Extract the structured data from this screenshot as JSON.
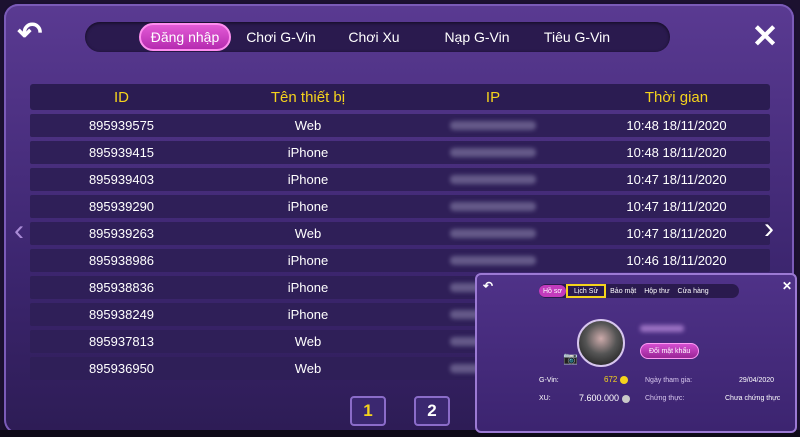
{
  "nav": {
    "tabs": [
      {
        "label": "Đăng nhập"
      },
      {
        "label": "Chơi G-Vin"
      },
      {
        "label": "Chơi Xu"
      },
      {
        "label": "Nạp G-Vin"
      },
      {
        "label": "Tiêu G-Vin"
      }
    ],
    "active_tab": 0
  },
  "table": {
    "headers": [
      "ID",
      "Tên thiết bị",
      "IP",
      "Thời gian"
    ],
    "rows": [
      {
        "id": "895939575",
        "device": "Web",
        "time": "10:48 18/11/2020"
      },
      {
        "id": "895939415",
        "device": "iPhone",
        "time": "10:48 18/11/2020"
      },
      {
        "id": "895939403",
        "device": "iPhone",
        "time": "10:47 18/11/2020"
      },
      {
        "id": "895939290",
        "device": "iPhone",
        "time": "10:47 18/11/2020"
      },
      {
        "id": "895939263",
        "device": "Web",
        "time": "10:47 18/11/2020"
      },
      {
        "id": "895938986",
        "device": "iPhone",
        "time": "10:46 18/11/2020"
      },
      {
        "id": "895938836",
        "device": "iPhone",
        "time": ""
      },
      {
        "id": "895938249",
        "device": "iPhone",
        "time": ""
      },
      {
        "id": "895937813",
        "device": "Web",
        "time": ""
      },
      {
        "id": "895936950",
        "device": "Web",
        "time": ""
      }
    ]
  },
  "pagination": {
    "pages": [
      "1",
      "2"
    ],
    "current": "1"
  },
  "inset": {
    "tabs": [
      "Hồ sơ",
      "Lịch Sử",
      "Bảo mật",
      "Hộp thư",
      "Cửa hàng"
    ],
    "change_password": "Đổi mật khẩu",
    "gvin_label": "G-Vin:",
    "gvin_value": "672",
    "xu_label": "XU:",
    "xu_value": "7.600.000",
    "join_label": "Ngày tham gia:",
    "join_value": "29/04/2020",
    "verify_label": "Chứng thực:",
    "verify_value": "Chưa chứng thực"
  },
  "colors": {
    "accent": "#f5d31c",
    "active_tab": "#c33bbd",
    "panel": "#3d2670"
  },
  "icons": {
    "back": "back-arrow-icon",
    "close": "close-icon",
    "prev": "chevron-left-icon",
    "next": "chevron-right-icon"
  }
}
